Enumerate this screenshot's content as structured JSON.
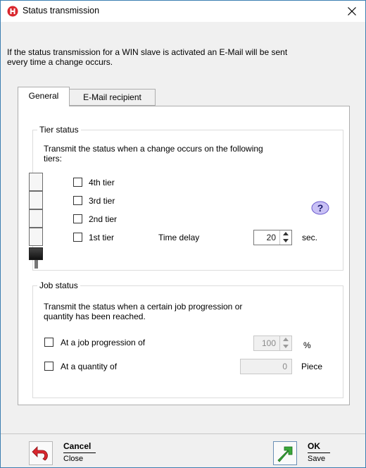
{
  "window": {
    "title": "Status transmission"
  },
  "intro": {
    "line1": "If the status transmission for a WIN slave is activated an E-Mail will be sent",
    "line2": "every time a change occurs."
  },
  "tabs": [
    {
      "label": "General",
      "selected": true
    },
    {
      "label": "E-Mail recipient",
      "selected": false
    }
  ],
  "tier_status": {
    "group_title": "Tier status",
    "description_line1": "Transmit the status when a change occurs on the following",
    "description_line2": "tiers:",
    "tiers": [
      {
        "label": "4th tier",
        "checked": false
      },
      {
        "label": "3rd tier",
        "checked": false
      },
      {
        "label": "2nd tier",
        "checked": false
      },
      {
        "label": "1st tier",
        "checked": false
      }
    ],
    "time_delay": {
      "label": "Time delay",
      "value": "20",
      "unit": "sec."
    },
    "help_icon": "question-mark"
  },
  "job_status": {
    "group_title": "Job status",
    "description_line1": "Transmit the status when a certain job progression or",
    "description_line2": "quantity has been reached.",
    "progression": {
      "label": "At a job progression of",
      "value": "100",
      "unit": "%",
      "checked": false
    },
    "quantity": {
      "label": "At a quantity of",
      "value": "0",
      "unit": "Piece",
      "checked": false
    }
  },
  "footer": {
    "cancel": {
      "title": "Cancel",
      "subtitle": "Close"
    },
    "ok": {
      "title": "OK",
      "subtitle": "Save"
    }
  },
  "colors": {
    "accent_border": "#3c7fb1",
    "cancel_icon": "#d9272e",
    "ok_icon": "#3aa83a",
    "help_icon": "#6a5acd"
  }
}
